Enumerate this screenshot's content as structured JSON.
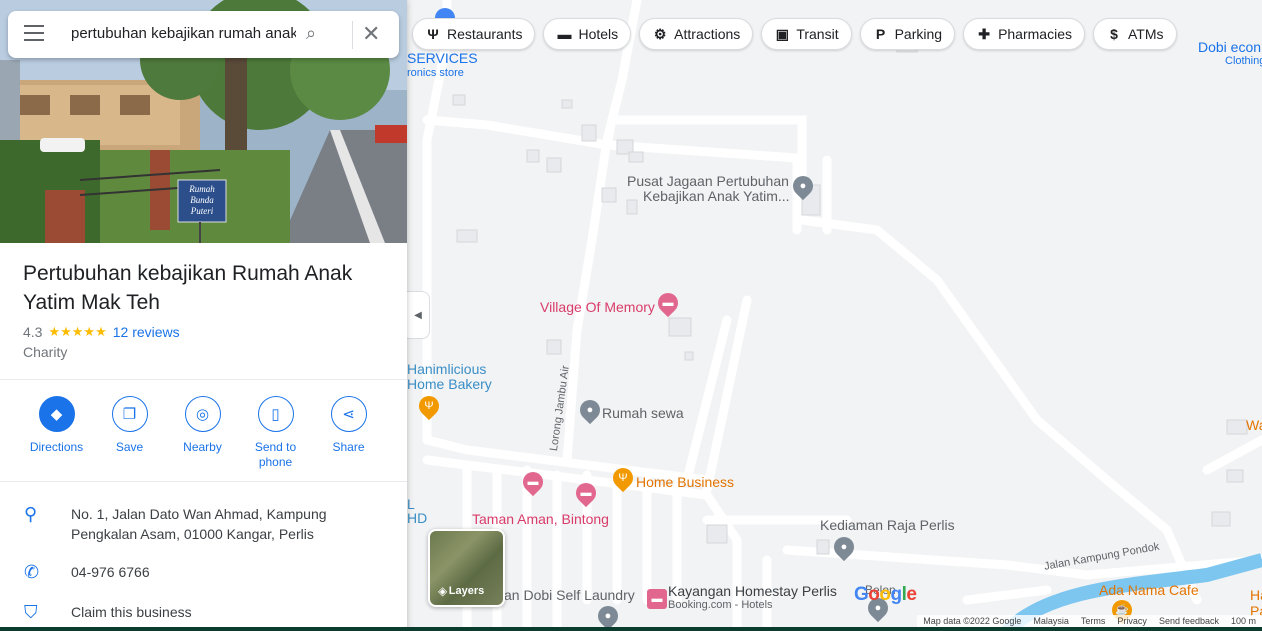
{
  "search": {
    "query": "pertubuhan kebajikan rumah anak yatim mak teh"
  },
  "place": {
    "title": "Pertubuhan kebajikan Rumah Anak Yatim Mak Teh",
    "rating": "4.3",
    "stars": "★★★★★",
    "reviews": "12 reviews",
    "category": "Charity",
    "photo_sign": "Rumah Bunda Puteri"
  },
  "actions": [
    {
      "label": "Directions",
      "icon": "directions-icon"
    },
    {
      "label": "Save",
      "icon": "bookmark-icon"
    },
    {
      "label": "Nearby",
      "icon": "nearby-icon"
    },
    {
      "label": "Send to phone",
      "icon": "phone-send-icon"
    },
    {
      "label": "Share",
      "icon": "share-icon"
    }
  ],
  "info": {
    "address": "No. 1, Jalan Dato Wan Ahmad, Kampung Pengkalan Asam, 01000 Kangar, Perlis",
    "phone": "04-976 6766",
    "claim": "Claim this business"
  },
  "chips": [
    {
      "label": "Restaurants",
      "icon": "fork-knife-icon"
    },
    {
      "label": "Hotels",
      "icon": "bed-icon"
    },
    {
      "label": "Attractions",
      "icon": "attractions-icon"
    },
    {
      "label": "Transit",
      "icon": "transit-icon"
    },
    {
      "label": "Parking",
      "icon": "parking-icon"
    },
    {
      "label": "Pharmacies",
      "icon": "pharmacy-icon"
    },
    {
      "label": "ATMs",
      "icon": "atm-icon"
    }
  ],
  "map_labels": {
    "services": "SERVICES",
    "services_sub": "ronics store",
    "dobi": "Dobi econ",
    "dobi_sub": "Clothing",
    "pusat_line1": "Pusat Jagaan Pertubuhan",
    "pusat_line2": "Kebajikan Anak Yatim...",
    "village": "Village Of Memory",
    "hanim_line1": "Hanimlicious",
    "hanim_line2": "Home Bakery",
    "lorong": "Lorong Jambu Air",
    "rumah_sewa": "Rumah sewa",
    "home_business": "Home Business",
    "taman_aman": "Taman Aman, Bintong",
    "kediaman": "Kediaman Raja Perlis",
    "jalan_kampung": "Jalan Kampung Pondok",
    "ada_nama": "Ada Nama Cafe",
    "dobi_self": "an Dobi Self Laundry",
    "kayangan": "Kayangan Homestay Perlis",
    "kayangan_sub": "Booking.com - Hotels",
    "belon": "Belon",
    "hd": "HD",
    "l_edge": "L",
    "wa": "Wa",
    "ha": "Ha",
    "pa": "Pa"
  },
  "layers": {
    "label": "Layers"
  },
  "google_logo": "Google",
  "footer": [
    "Map data ©2022 Google",
    "Malaysia",
    "Terms",
    "Privacy",
    "Send feedback",
    "100 m"
  ]
}
